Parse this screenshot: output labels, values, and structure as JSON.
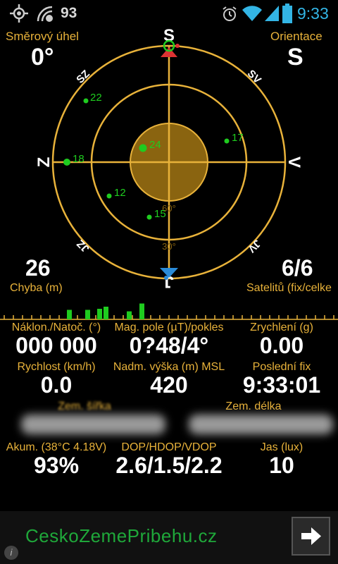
{
  "status_bar": {
    "battery_level": "93",
    "time": "9:33"
  },
  "compass": {
    "heading_label": "Směrový úhel",
    "heading_value": "0°",
    "orientation_label": "Orientace",
    "orientation_value": "S",
    "dirs": {
      "n": "S",
      "s": "J",
      "e": "V",
      "w": "Z",
      "ne": "SV",
      "nw": "SZ",
      "se": "JV",
      "sw": "JZ"
    },
    "elev_60": "60°",
    "elev_30": "30°",
    "satellites": [
      {
        "id": "22"
      },
      {
        "id": "17"
      },
      {
        "id": "24"
      },
      {
        "id": "18"
      },
      {
        "id": "12"
      },
      {
        "id": "15"
      }
    ]
  },
  "accuracy": {
    "value": "26",
    "label": "Chyba (m)"
  },
  "sats": {
    "value": "6/6",
    "label": "Satelitů (fix/celke"
  },
  "signal_bars": [
    0.15,
    0.25,
    0.3,
    0.4,
    0.45,
    0.6,
    0.7,
    0.5,
    0.7,
    0.9,
    0.4,
    0.6
  ],
  "grid": [
    {
      "label": "Náklon./Natoč. (°)",
      "value": "000 000"
    },
    {
      "label": "Mag. pole (µT)/pokles",
      "value": "0?48/4°"
    },
    {
      "label": "Zrychlení (g)",
      "value": "0.00"
    },
    {
      "label": "Rychlost (km/h)",
      "value": "0.0"
    },
    {
      "label": "Nadm. výška (m) MSL",
      "value": "420"
    },
    {
      "label": "Poslední fix",
      "value": "9:33:01"
    },
    {
      "label": "Zem. šířka",
      "value": ""
    },
    {
      "label": "Zem. délka",
      "value": ""
    },
    {
      "label": "",
      "value": ""
    },
    {
      "label": "Akum. (38°C 4.18V)",
      "value": "93%"
    },
    {
      "label": "DOP/HDOP/VDOP",
      "value": "2.6/1.5/2.2"
    },
    {
      "label": "Jas (lux)",
      "value": "10"
    }
  ],
  "ad": {
    "text": "CeskoZemePribehu.cz",
    "info": "i"
  },
  "colors": {
    "gold": "#e8b23a",
    "green": "#1fcc1f",
    "blue": "#2a8bd8",
    "red": "#d33",
    "clock": "#33b5e5"
  }
}
